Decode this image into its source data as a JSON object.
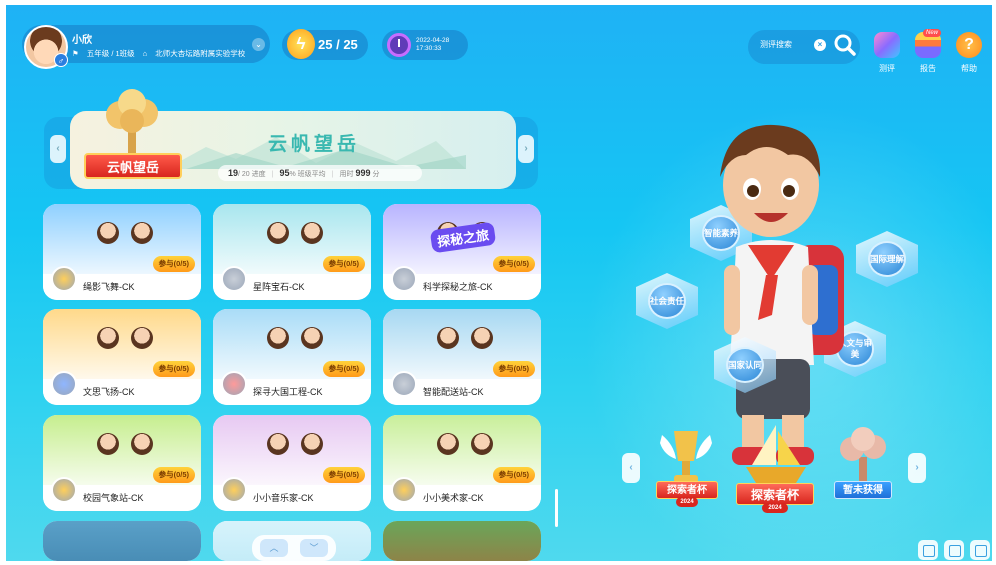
{
  "user": {
    "name": "小欣",
    "grade": "五年级 / 1班级",
    "school": "北师大杏坛路附属实验学校",
    "gender_icon": "male-symbol"
  },
  "energy": {
    "current": "25",
    "separator": " / ",
    "max": "25"
  },
  "datetime": {
    "date": "2022-04-28",
    "time": "17:30:33"
  },
  "search": {
    "placeholder": "测评搜索"
  },
  "toolbar": {
    "eval_label": "测评",
    "report_label": "报告",
    "help_label": "帮助",
    "new_badge": "New"
  },
  "banner": {
    "title": "云帆望岳",
    "ribbon": "云帆望岳",
    "progress_done": "19",
    "progress_total": "/ 20",
    "progress_label": "进度",
    "percent_value": "95",
    "percent_label": "% 班级平均",
    "time_label": "用时",
    "time_value": "999",
    "time_unit": "分"
  },
  "cards": [
    {
      "name": "绳影飞舞-CK",
      "join": "参与",
      "count": "(0/5)",
      "art_color": "#8fd0ff"
    },
    {
      "name": "星阵宝石-CK",
      "join": "参与",
      "count": "(0/5)",
      "art_color": "#a8e6ee"
    },
    {
      "name": "科学探秘之旅-CK",
      "join": "参与",
      "count": "(0/5)",
      "art_color": "#b8b4ff",
      "art_text": "探秘之旅"
    },
    {
      "name": "文思飞扬-CK",
      "join": "参与",
      "count": "(0/5)",
      "art_color": "#ffd98a"
    },
    {
      "name": "探寻大国工程-CK",
      "join": "参与",
      "count": "(0/5)",
      "art_color": "#a9dcf7"
    },
    {
      "name": "智能配送站-CK",
      "join": "参与",
      "count": "(0/5)",
      "art_color": "#a7d8f2"
    },
    {
      "name": "校园气象站-CK",
      "join": "参与",
      "count": "(0/5)",
      "art_color": "#c6ee8e"
    },
    {
      "name": "小小音乐家-CK",
      "join": "参与",
      "count": "(0/5)",
      "art_color": "#e7c9f2"
    },
    {
      "name": "小小美术家-CK",
      "join": "参与",
      "count": "(0/5)",
      "art_color": "#c9ef9a"
    }
  ],
  "competencies": [
    "智能素养",
    "国际理解",
    "社会责任",
    "人文与审美",
    "国家认同"
  ],
  "trophies": [
    {
      "label": "探索者杯",
      "year": "2024"
    },
    {
      "label": "探索者杯",
      "year": "2024"
    },
    {
      "label": "暂未获得"
    }
  ],
  "pager": {
    "up": "︿",
    "down": "﹀"
  },
  "nav": {
    "prev": "‹",
    "next": "›"
  }
}
